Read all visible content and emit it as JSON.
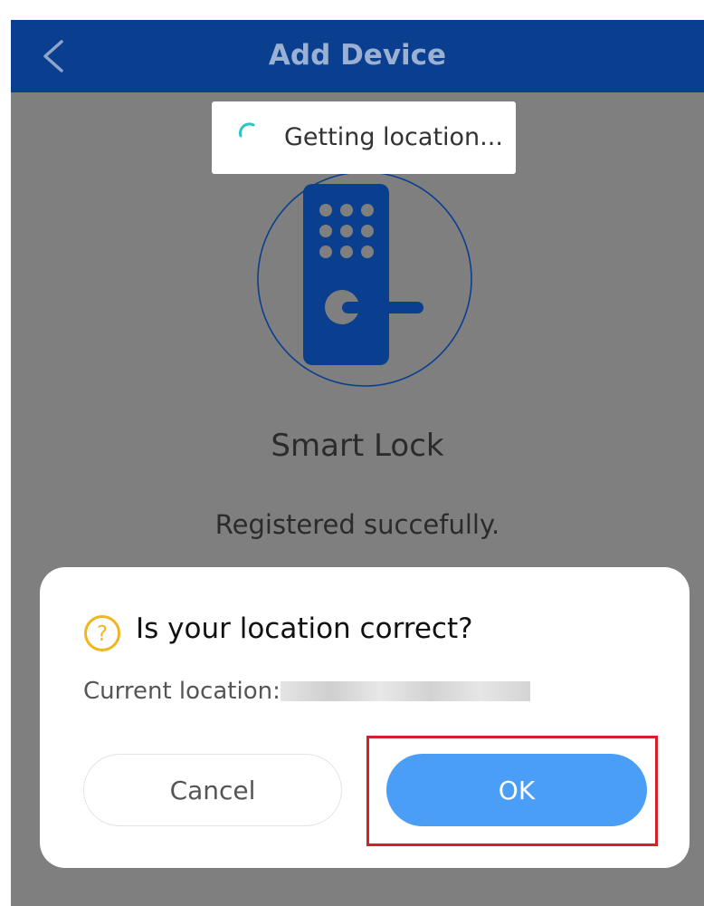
{
  "header": {
    "title": "Add Device",
    "back_icon": "chevron-left-icon"
  },
  "toast": {
    "text": "Getting location...",
    "icon": "spinner-icon"
  },
  "device": {
    "name": "Smart Lock",
    "status": "Registered succefully.",
    "illustration_icon": "smart-lock-icon"
  },
  "dialog": {
    "title": "Is your location correct?",
    "icon": "question-icon",
    "location_label": "Current location:",
    "cancel_label": "Cancel",
    "ok_label": "OK"
  },
  "colors": {
    "appbar": "#0a3f8f",
    "overlay": "#7f7f7f",
    "primary_button": "#4a9ef5",
    "question_icon": "#f2b51d",
    "highlight": "#d51f2b",
    "spinner": "#2ec4c4"
  }
}
